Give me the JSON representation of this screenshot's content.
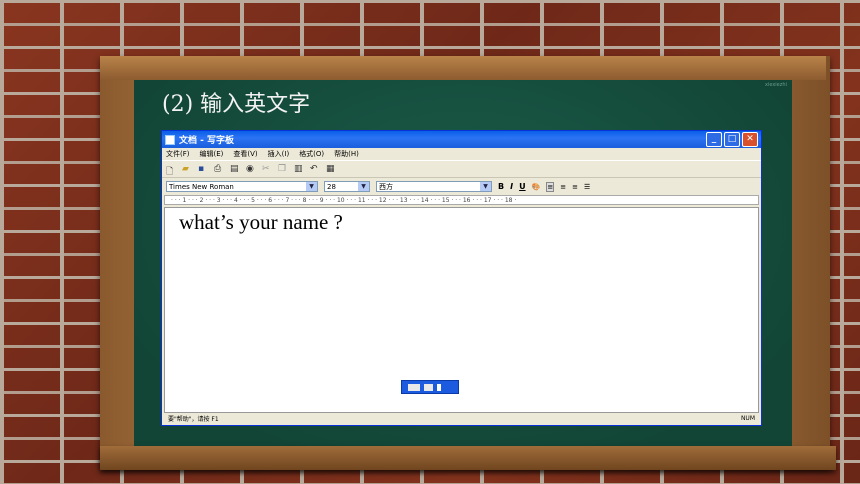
{
  "slide": {
    "title": "(2) 输入英文字",
    "watermark": "xiexiezhi"
  },
  "window": {
    "title": "文档 - 写字板",
    "controls": [
      "minimize",
      "maximize",
      "close"
    ]
  },
  "menubar": {
    "items": [
      "文件(F)",
      "编辑(E)",
      "查看(V)",
      "插入(I)",
      "格式(O)",
      "帮助(H)"
    ]
  },
  "toolbar": {
    "icons": [
      "new-icon",
      "open-icon",
      "save-icon",
      "print-icon",
      "print-preview-icon",
      "find-icon",
      "cut-icon",
      "copy-icon",
      "paste-icon",
      "undo-icon",
      "insert-datetime-icon"
    ]
  },
  "format_bar": {
    "font": "Times New Roman",
    "size": "28",
    "script": "西方",
    "bold_label": "B",
    "italic_label": "I",
    "underline_label": "U"
  },
  "ruler": {
    "text": "· · · 1 · · · 2 · · · 3 · · · 4 · · · 5 · · · 6 · · · 7 · · · 8 · · · 9 · · · 10 · · · 11 · · · 12 · · · 13 · · · 14 · · · 15 · · · 16 · · · 17 · · · 18 ·"
  },
  "document": {
    "text": "what’s your name ?"
  },
  "statusbar": {
    "help": "要\"帮助\"，请按 F1",
    "num": "NUM"
  }
}
